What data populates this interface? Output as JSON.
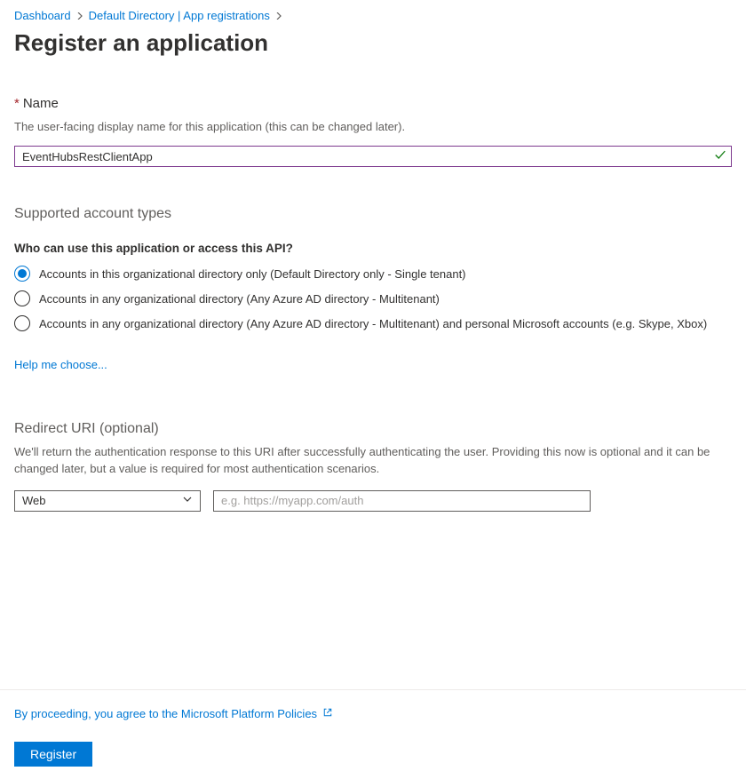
{
  "breadcrumb": {
    "items": [
      "Dashboard",
      "Default Directory | App registrations"
    ]
  },
  "title": "Register an application",
  "nameSection": {
    "asterisk": "*",
    "label": "Name",
    "hint": "The user-facing display name for this application (this can be changed later).",
    "value": "EventHubsRestClientApp"
  },
  "accountTypes": {
    "heading": "Supported account types",
    "question": "Who can use this application or access this API?",
    "options": [
      {
        "label": "Accounts in this organizational directory only (Default Directory only - Single tenant)",
        "selected": true
      },
      {
        "label": "Accounts in any organizational directory (Any Azure AD directory - Multitenant)",
        "selected": false
      },
      {
        "label": "Accounts in any organizational directory (Any Azure AD directory - Multitenant) and personal Microsoft accounts (e.g. Skype, Xbox)",
        "selected": false
      }
    ],
    "helpLink": "Help me choose..."
  },
  "redirect": {
    "heading": "Redirect URI (optional)",
    "desc": "We'll return the authentication response to this URI after successfully authenticating the user. Providing this now is optional and it can be changed later, but a value is required for most authentication scenarios.",
    "platformSelected": "Web",
    "uriPlaceholder": "e.g. https://myapp.com/auth",
    "uriValue": ""
  },
  "footer": {
    "policy": "By proceeding, you agree to the Microsoft Platform Policies",
    "registerLabel": "Register"
  }
}
